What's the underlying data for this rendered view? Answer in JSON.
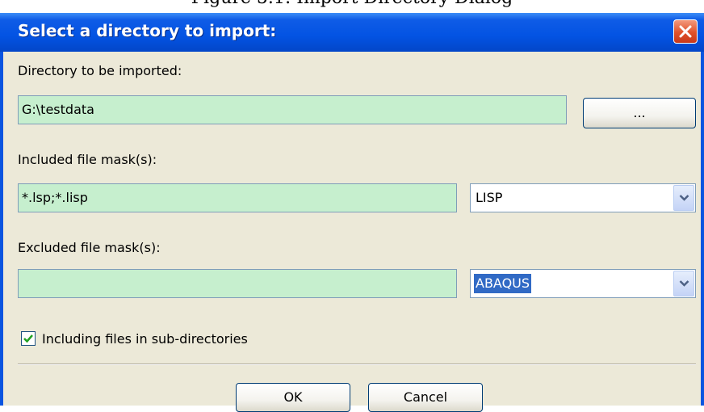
{
  "caption": "Figure 5.1: Import Directory Dialog",
  "window": {
    "title": "Select a directory to import:",
    "close_icon": "close-icon"
  },
  "directory": {
    "label": "Directory to be imported:",
    "value": "G:\\testdata",
    "browse_label": "..."
  },
  "included": {
    "label": "Included file mask(s):",
    "value": "*.lsp;*.lisp",
    "selected": "LISP"
  },
  "excluded": {
    "label": "Excluded file mask(s):",
    "value": "",
    "selected": "ABAQUS"
  },
  "subdirs": {
    "label": "Including files in sub-directories",
    "checked": true
  },
  "buttons": {
    "ok": "OK",
    "cancel": "Cancel"
  },
  "colors": {
    "titlebar": "#0353e3",
    "field_background": "#c6efce",
    "selection": "#316ac5",
    "close_button": "#e0512a"
  }
}
